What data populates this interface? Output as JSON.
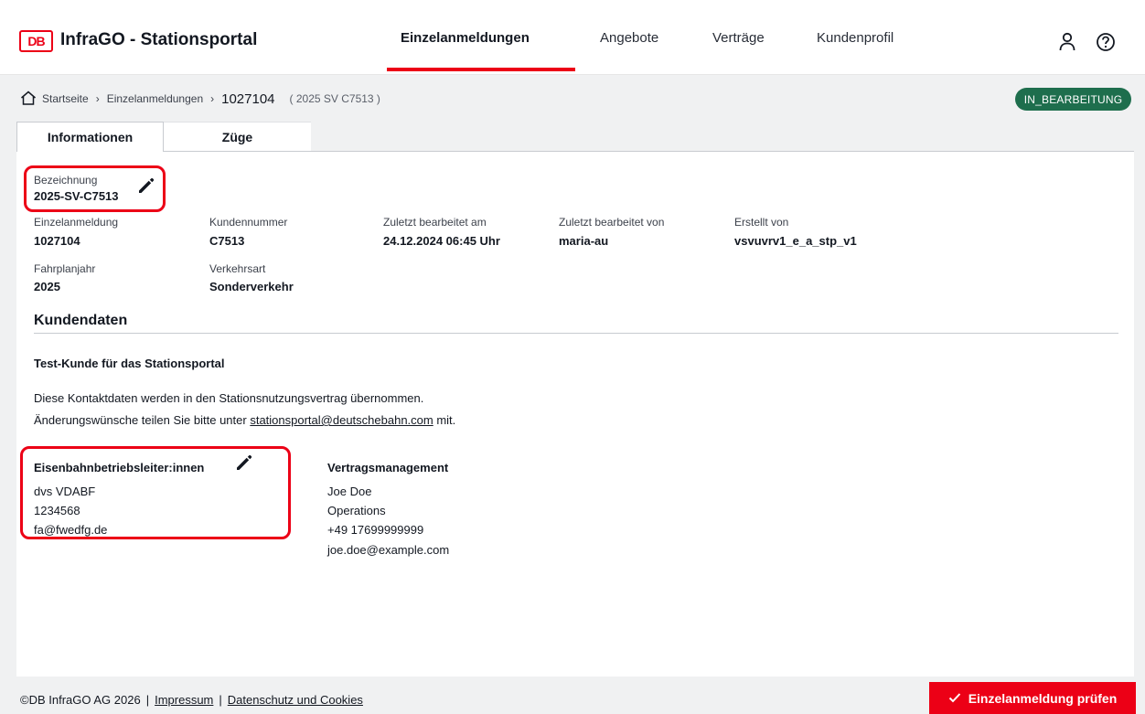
{
  "header": {
    "logo_text": "DB",
    "app_title": "InfraGO - Stationsportal",
    "nav": [
      {
        "label": "Einzelanmeldungen",
        "active": true
      },
      {
        "label": "Angebote",
        "active": false
      },
      {
        "label": "Verträge",
        "active": false
      },
      {
        "label": "Kundenprofil",
        "active": false
      }
    ],
    "icons": [
      "user-icon",
      "help-icon"
    ]
  },
  "breadcrumb": {
    "items": [
      "Startseite",
      "Einzelanmeldungen"
    ],
    "current": "1027104",
    "sub": "( 2025 SV C7513 )"
  },
  "status_badge": "IN_BEARBEITUNG",
  "tabs": [
    {
      "label": "Informationen",
      "active": true
    },
    {
      "label": "Züge",
      "active": false
    }
  ],
  "info": {
    "bezeichnung": {
      "label": "Bezeichnung",
      "value": "2025-SV-C7513"
    },
    "einzelanmeldung": {
      "label": "Einzelanmeldung",
      "value": "1027104"
    },
    "kundennummer": {
      "label": "Kundennummer",
      "value": "C7513"
    },
    "zuletzt_am": {
      "label": "Zuletzt bearbeitet am",
      "value": "24.12.2024 06:45 Uhr"
    },
    "zuletzt_von": {
      "label": "Zuletzt bearbeitet von",
      "value": "maria-au"
    },
    "erstellt_von": {
      "label": "Erstellt von",
      "value": "vsvuvrv1_e_a_stp_v1"
    },
    "fahrplanjahr": {
      "label": "Fahrplanjahr",
      "value": "2025"
    },
    "verkehrsart": {
      "label": "Verkehrsart",
      "value": "Sonderverkehr"
    }
  },
  "kundendaten": {
    "title": "Kundendaten",
    "customer_name": "Test-Kunde für das Stationsportal",
    "note_line1": "Diese Kontaktdaten werden in den Stationsnutzungsvertrag übernommen.",
    "note_line2_prefix": "Änderungswünsche teilen Sie bitte unter",
    "note_link": "stationsportal@deutschebahn.com",
    "note_line2_suffix": "mit.",
    "betriebsleiter": {
      "title": "Eisenbahnbetriebsleiter:innen",
      "lines": [
        "dvs VDABF",
        "1234568",
        "fa@fwedfg.de"
      ]
    },
    "vertragsmanagement": {
      "title": "Vertragsmanagement",
      "lines": [
        "Joe Doe",
        "Operations",
        "+49 17699999999",
        "joe.doe@example.com"
      ]
    }
  },
  "footer": {
    "copyright": "©DB InfraGO AG 2026",
    "impressum": "Impressum",
    "datenschutz": "Datenschutz und Cookies",
    "check_button": "Einzelanmeldung prüfen"
  },
  "colors": {
    "brand_red": "#ec0016",
    "status_green": "#1e6e4d",
    "frame_grey": "#f0f1f2"
  }
}
